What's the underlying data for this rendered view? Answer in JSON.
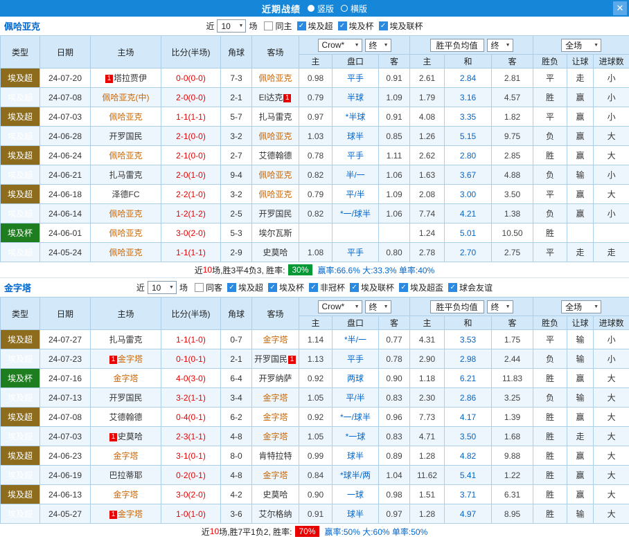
{
  "topbar": {
    "title": "近期战绩",
    "radios": [
      {
        "label": "竖版",
        "selected": true
      },
      {
        "label": "横版",
        "selected": false
      }
    ],
    "close": "✕"
  },
  "colors": {
    "titlebar_blue": "#1586d8",
    "accent_blue": "#0066cc",
    "highlight_team_orange": "#cc6600",
    "league_tag_brown": "#8d6c1e",
    "cup_tag_green": "#1e7d1e",
    "win_red": "#e60000",
    "draw_blue": "#0066cc",
    "lose_green": "#009933",
    "rate_badge_green": "#009933",
    "rate_badge_red": "#e60000"
  },
  "sections": [
    {
      "team": "佩哈亚克",
      "filter": {
        "near": "近",
        "count": "10",
        "games": "场",
        "same": {
          "label": "同主",
          "checked": false
        },
        "leagues": [
          {
            "label": "埃及超",
            "checked": true
          },
          {
            "label": "埃及杯",
            "checked": true
          },
          {
            "label": "埃及联杯",
            "checked": true
          }
        ]
      },
      "header": {
        "type": "类型",
        "date": "日期",
        "home": "主场",
        "score": "比分(半场)",
        "corner": "角球",
        "away": "客场",
        "bookmaker": "Crow*",
        "odds_final": "终",
        "avg_label": "胜平负均值",
        "avg_final": "终",
        "scope": "全场",
        "sub": [
          "主",
          "盘口",
          "客",
          "主",
          "和",
          "客",
          "胜负",
          "让球",
          "进球数"
        ]
      },
      "rows": [
        {
          "league": "埃及超",
          "cup": false,
          "date": "24-07-20",
          "home": {
            "name": "塔拉贾伊",
            "pre": "1",
            "hl": false
          },
          "score": "0-0(0-0)",
          "corner": "7-3",
          "away": {
            "name": "佩哈亚克",
            "hl": true
          },
          "o1": "0.98",
          "line": "平手",
          "o2": "0.91",
          "a1": "2.61",
          "a2": "2.84",
          "a3": "2.81",
          "res": [
            "平",
            "blue"
          ],
          "han": [
            "走",
            "blue"
          ],
          "gol": [
            "小",
            "green"
          ]
        },
        {
          "league": "埃及超",
          "cup": false,
          "date": "24-07-08",
          "home": {
            "name": "佩哈亚克(中)",
            "hl": true
          },
          "score": "2-0(0-0)",
          "corner": "2-1",
          "away": {
            "name": "El达克",
            "post": "1",
            "hl": false
          },
          "o1": "0.79",
          "line": "半球",
          "o2": "1.09",
          "a1": "1.79",
          "a2": "3.16",
          "a3": "4.57",
          "res": [
            "胜",
            "red"
          ],
          "han": [
            "赢",
            "red"
          ],
          "gol": [
            "小",
            "green"
          ]
        },
        {
          "league": "埃及超",
          "cup": false,
          "date": "24-07-03",
          "home": {
            "name": "佩哈亚克",
            "hl": true
          },
          "score": "1-1(1-1)",
          "corner": "5-7",
          "away": {
            "name": "扎马雷克",
            "hl": false
          },
          "o1": "0.97",
          "line": "*半球",
          "o2": "0.91",
          "a1": "4.08",
          "a2": "3.35",
          "a3": "1.82",
          "res": [
            "平",
            "blue"
          ],
          "han": [
            "赢",
            "red"
          ],
          "gol": [
            "小",
            "green"
          ]
        },
        {
          "league": "埃及超",
          "cup": false,
          "date": "24-06-28",
          "home": {
            "name": "开罗国民",
            "hl": false
          },
          "score": "2-1(0-0)",
          "corner": "3-2",
          "away": {
            "name": "佩哈亚克",
            "hl": true
          },
          "o1": "1.03",
          "line": "球半",
          "o2": "0.85",
          "a1": "1.26",
          "a2": "5.15",
          "a3": "9.75",
          "res": [
            "负",
            "green"
          ],
          "han": [
            "赢",
            "red"
          ],
          "gol": [
            "大",
            "red"
          ]
        },
        {
          "league": "埃及超",
          "cup": false,
          "date": "24-06-24",
          "home": {
            "name": "佩哈亚克",
            "hl": true
          },
          "score": "2-1(0-0)",
          "corner": "2-7",
          "away": {
            "name": "艾德翰德",
            "hl": false
          },
          "o1": "0.78",
          "line": "平手",
          "o2": "1.11",
          "a1": "2.62",
          "a2": "2.80",
          "a3": "2.85",
          "res": [
            "胜",
            "red"
          ],
          "han": [
            "赢",
            "red"
          ],
          "gol": [
            "大",
            "red"
          ]
        },
        {
          "league": "埃及超",
          "cup": false,
          "date": "24-06-21",
          "home": {
            "name": "扎马雷克",
            "hl": false
          },
          "score": "2-0(1-0)",
          "corner": "9-4",
          "away": {
            "name": "佩哈亚克",
            "hl": true
          },
          "o1": "0.82",
          "line": "半/一",
          "o2": "1.06",
          "a1": "1.63",
          "a2": "3.67",
          "a3": "4.88",
          "res": [
            "负",
            "green"
          ],
          "han": [
            "输",
            "green"
          ],
          "gol": [
            "小",
            "green"
          ]
        },
        {
          "league": "埃及超",
          "cup": false,
          "date": "24-06-18",
          "home": {
            "name": "泽德FC",
            "hl": false
          },
          "score": "2-2(1-0)",
          "corner": "3-2",
          "away": {
            "name": "佩哈亚克",
            "hl": true
          },
          "o1": "0.79",
          "line": "平/半",
          "o2": "1.09",
          "a1": "2.08",
          "a2": "3.00",
          "a3": "3.50",
          "res": [
            "平",
            "blue"
          ],
          "han": [
            "赢",
            "red"
          ],
          "gol": [
            "大",
            "red"
          ]
        },
        {
          "league": "埃及超",
          "cup": false,
          "date": "24-06-14",
          "home": {
            "name": "佩哈亚克",
            "hl": true
          },
          "score": "1-2(1-2)",
          "corner": "2-5",
          "away": {
            "name": "开罗国民",
            "hl": false
          },
          "o1": "0.82",
          "line": "*一/球半",
          "o2": "1.06",
          "a1": "7.74",
          "a2": "4.21",
          "a3": "1.38",
          "res": [
            "负",
            "green"
          ],
          "han": [
            "赢",
            "red"
          ],
          "gol": [
            "小",
            "green"
          ]
        },
        {
          "league": "埃及杯",
          "cup": true,
          "date": "24-06-01",
          "home": {
            "name": "佩哈亚克",
            "hl": true
          },
          "score": "3-0(2-0)",
          "corner": "5-3",
          "away": {
            "name": "埃尔瓦斯",
            "hl": false
          },
          "o1": "",
          "line": "",
          "o2": "",
          "a1": "1.24",
          "a2": "5.01",
          "a3": "10.50",
          "res": [
            "胜",
            "red"
          ],
          "han": [
            "",
            ""
          ],
          "gol": [
            "",
            ""
          ]
        },
        {
          "league": "埃及超",
          "cup": false,
          "date": "24-05-24",
          "home": {
            "name": "佩哈亚克",
            "hl": true
          },
          "score": "1-1(1-1)",
          "corner": "2-9",
          "away": {
            "name": "史莫哈",
            "hl": false
          },
          "o1": "1.08",
          "line": "平手",
          "o2": "0.80",
          "a1": "2.78",
          "a2": "2.70",
          "a3": "2.75",
          "res": [
            "平",
            "blue"
          ],
          "han": [
            "走",
            "blue"
          ],
          "gol": [
            "走",
            "blue"
          ]
        }
      ],
      "summary": {
        "near": "近",
        "count": "10",
        "text": "场,胜3平4负3, 胜率:",
        "badge": "30%",
        "badge_style": "background:#009933",
        "stats": "赢率:66.6% 大:33.3% 单率:40%"
      }
    },
    {
      "team": "金字塔",
      "filter": {
        "near": "近",
        "count": "10",
        "games": "场",
        "same": {
          "label": "同客",
          "checked": false
        },
        "leagues": [
          {
            "label": "埃及超",
            "checked": true
          },
          {
            "label": "埃及杯",
            "checked": true
          },
          {
            "label": "非冠杯",
            "checked": true
          },
          {
            "label": "埃及联杯",
            "checked": true
          },
          {
            "label": "埃及超盃",
            "checked": true
          },
          {
            "label": "球会友谊",
            "checked": true
          }
        ]
      },
      "header": {
        "type": "类型",
        "date": "日期",
        "home": "主场",
        "score": "比分(半场)",
        "corner": "角球",
        "away": "客场",
        "bookmaker": "Crow*",
        "odds_final": "终",
        "avg_label": "胜平负均值",
        "avg_final": "终",
        "scope": "全场",
        "sub": [
          "主",
          "盘口",
          "客",
          "主",
          "和",
          "客",
          "胜负",
          "让球",
          "进球数"
        ]
      },
      "rows": [
        {
          "league": "埃及超",
          "cup": false,
          "date": "24-07-27",
          "home": {
            "name": "扎马雷克",
            "hl": false
          },
          "score": "1-1(1-0)",
          "corner": "0-7",
          "away": {
            "name": "金字塔",
            "hl": true
          },
          "o1": "1.14",
          "line": "*半/一",
          "o2": "0.77",
          "a1": "4.31",
          "a2": "3.53",
          "a3": "1.75",
          "res": [
            "平",
            "blue"
          ],
          "han": [
            "输",
            "green"
          ],
          "gol": [
            "小",
            "green"
          ]
        },
        {
          "league": "埃及超",
          "cup": false,
          "date": "24-07-23",
          "home": {
            "name": "金字塔",
            "pre": "1",
            "hl": true
          },
          "score": "0-1(0-1)",
          "corner": "2-1",
          "away": {
            "name": "开罗国民",
            "post": "1",
            "hl": false
          },
          "o1": "1.13",
          "line": "平手",
          "o2": "0.78",
          "a1": "2.90",
          "a2": "2.98",
          "a3": "2.44",
          "res": [
            "负",
            "green"
          ],
          "han": [
            "输",
            "green"
          ],
          "gol": [
            "小",
            "green"
          ]
        },
        {
          "league": "埃及杯",
          "cup": true,
          "date": "24-07-16",
          "home": {
            "name": "金字塔",
            "hl": true
          },
          "score": "4-0(3-0)",
          "corner": "6-4",
          "away": {
            "name": "开罗纳萨",
            "hl": false
          },
          "o1": "0.92",
          "line": "两球",
          "o2": "0.90",
          "a1": "1.18",
          "a2": "6.21",
          "a3": "11.83",
          "res": [
            "胜",
            "red"
          ],
          "han": [
            "赢",
            "red"
          ],
          "gol": [
            "大",
            "red"
          ]
        },
        {
          "league": "埃及超",
          "cup": false,
          "date": "24-07-13",
          "home": {
            "name": "开罗国民",
            "hl": false
          },
          "score": "3-2(1-1)",
          "corner": "3-4",
          "away": {
            "name": "金字塔",
            "hl": true
          },
          "o1": "1.05",
          "line": "平/半",
          "o2": "0.83",
          "a1": "2.30",
          "a2": "2.86",
          "a3": "3.25",
          "res": [
            "负",
            "green"
          ],
          "han": [
            "输",
            "green"
          ],
          "gol": [
            "大",
            "red"
          ]
        },
        {
          "league": "埃及超",
          "cup": false,
          "date": "24-07-08",
          "home": {
            "name": "艾德翰德",
            "hl": false
          },
          "score": "0-4(0-1)",
          "corner": "6-2",
          "away": {
            "name": "金字塔",
            "hl": true
          },
          "o1": "0.92",
          "line": "*一/球半",
          "o2": "0.96",
          "a1": "7.73",
          "a2": "4.17",
          "a3": "1.39",
          "res": [
            "胜",
            "red"
          ],
          "han": [
            "赢",
            "red"
          ],
          "gol": [
            "大",
            "red"
          ]
        },
        {
          "league": "埃及超",
          "cup": false,
          "date": "24-07-03",
          "home": {
            "name": "史莫哈",
            "pre": "1",
            "hl": false
          },
          "score": "2-3(1-1)",
          "corner": "4-8",
          "away": {
            "name": "金字塔",
            "hl": true
          },
          "o1": "1.05",
          "line": "*一球",
          "o2": "0.83",
          "a1": "4.71",
          "a2": "3.50",
          "a3": "1.68",
          "res": [
            "胜",
            "red"
          ],
          "han": [
            "走",
            "blue"
          ],
          "gol": [
            "大",
            "red"
          ]
        },
        {
          "league": "埃及超",
          "cup": false,
          "date": "24-06-23",
          "home": {
            "name": "金字塔",
            "hl": true
          },
          "score": "3-1(0-1)",
          "corner": "8-0",
          "away": {
            "name": "肯特拉特",
            "hl": false
          },
          "o1": "0.99",
          "line": "球半",
          "o2": "0.89",
          "a1": "1.28",
          "a2": "4.82",
          "a3": "9.88",
          "res": [
            "胜",
            "red"
          ],
          "han": [
            "赢",
            "red"
          ],
          "gol": [
            "大",
            "red"
          ]
        },
        {
          "league": "埃及超",
          "cup": false,
          "date": "24-06-19",
          "home": {
            "name": "巴拉蒂耶",
            "hl": false
          },
          "score": "0-2(0-1)",
          "corner": "4-8",
          "away": {
            "name": "金字塔",
            "hl": true
          },
          "o1": "0.84",
          "line": "*球半/两",
          "o2": "1.04",
          "a1": "11.62",
          "a2": "5.41",
          "a3": "1.22",
          "res": [
            "胜",
            "red"
          ],
          "han": [
            "赢",
            "red"
          ],
          "gol": [
            "大",
            "red"
          ]
        },
        {
          "league": "埃及超",
          "cup": false,
          "date": "24-06-13",
          "home": {
            "name": "金字塔",
            "hl": true
          },
          "score": "3-0(2-0)",
          "corner": "4-2",
          "away": {
            "name": "史莫哈",
            "hl": false
          },
          "o1": "0.90",
          "line": "一球",
          "o2": "0.98",
          "a1": "1.51",
          "a2": "3.71",
          "a3": "6.31",
          "res": [
            "胜",
            "red"
          ],
          "han": [
            "赢",
            "red"
          ],
          "gol": [
            "大",
            "red"
          ]
        },
        {
          "league": "埃及超",
          "cup": false,
          "date": "24-05-27",
          "home": {
            "name": "金字塔",
            "pre": "1",
            "hl": true
          },
          "score": "1-0(1-0)",
          "corner": "3-6",
          "away": {
            "name": "艾尔格纳",
            "hl": false
          },
          "o1": "0.91",
          "line": "球半",
          "o2": "0.97",
          "a1": "1.28",
          "a2": "4.97",
          "a3": "8.95",
          "res": [
            "胜",
            "red"
          ],
          "han": [
            "输",
            "green"
          ],
          "gol": [
            "大",
            "red"
          ]
        }
      ],
      "summary": {
        "near": "近",
        "count": "10",
        "text": "场,胜7平1负2, 胜率:",
        "badge": "70%",
        "badge_style": "background:#e60000",
        "stats": "赢率:50% 大:60% 单率:50%"
      }
    }
  ]
}
